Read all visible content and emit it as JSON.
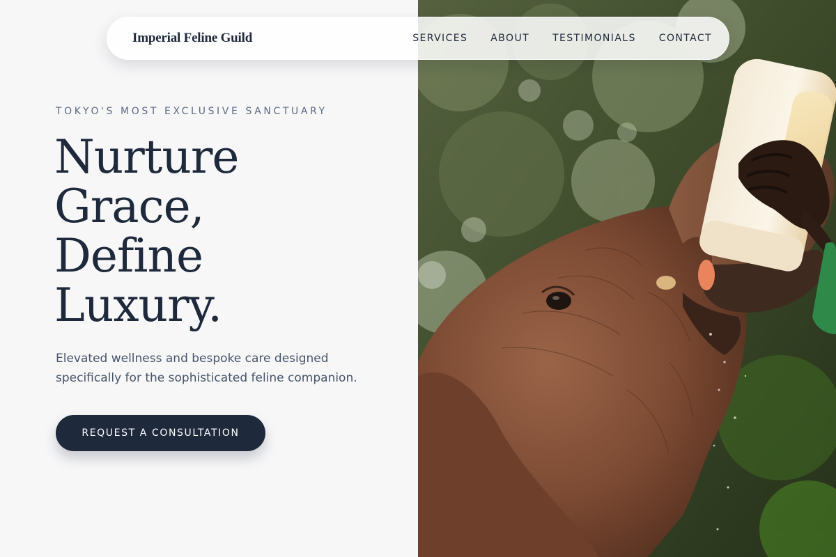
{
  "nav": {
    "brand": "Imperial Feline Guild",
    "links": [
      {
        "label": "SERVICES"
      },
      {
        "label": "ABOUT"
      },
      {
        "label": "TESTIMONIALS"
      },
      {
        "label": "CONTACT"
      }
    ]
  },
  "hero": {
    "eyebrow": "TOKYO'S MOST EXCLUSIVE SANCTUARY",
    "headline_lines": [
      "Nurture",
      "Grace,",
      "Define",
      "Luxury."
    ],
    "subtitle_lines": [
      "Elevated wellness and bespoke care designed",
      "specifically for the sophisticated feline companion."
    ],
    "cta_label": "REQUEST A CONSULTATION"
  },
  "colors": {
    "page_background": "#f7f7f8",
    "text_primary": "#1e293b",
    "text_muted": "#5d6b82",
    "button_background": "#1e293b",
    "button_text": "#ffffff"
  }
}
